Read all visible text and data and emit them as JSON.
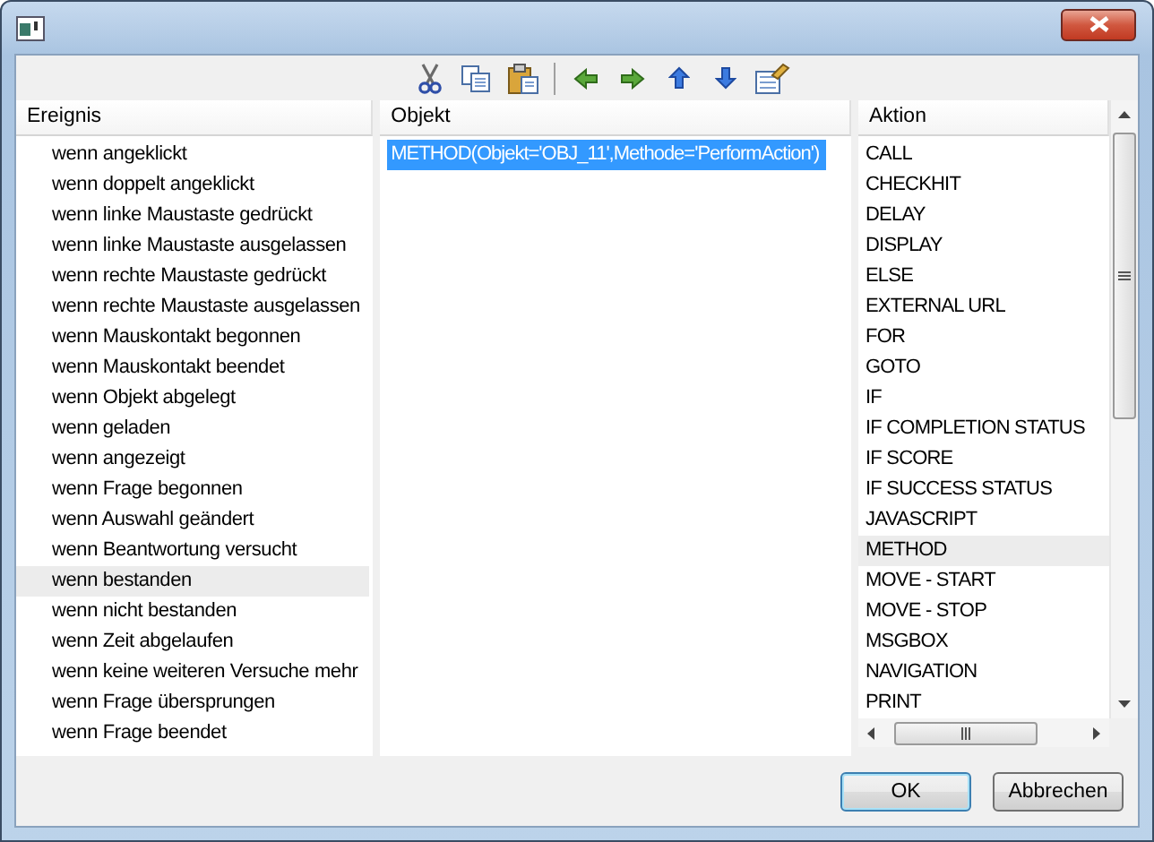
{
  "ereignis": {
    "heading": "Ereignis",
    "items": [
      {
        "label": "wenn angeklickt",
        "selected": false
      },
      {
        "label": "wenn doppelt angeklickt",
        "selected": false
      },
      {
        "label": "wenn linke Maustaste gedrückt",
        "selected": false
      },
      {
        "label": "wenn linke Maustaste ausgelassen",
        "selected": false
      },
      {
        "label": "wenn rechte Maustaste gedrückt",
        "selected": false
      },
      {
        "label": "wenn rechte Maustaste ausgelassen",
        "selected": false
      },
      {
        "label": "wenn Mauskontakt begonnen",
        "selected": false
      },
      {
        "label": "wenn Mauskontakt beendet",
        "selected": false
      },
      {
        "label": "wenn Objekt abgelegt",
        "selected": false
      },
      {
        "label": "wenn geladen",
        "selected": false
      },
      {
        "label": "wenn angezeigt",
        "selected": false
      },
      {
        "label": "wenn Frage begonnen",
        "selected": false
      },
      {
        "label": "wenn Auswahl geändert",
        "selected": false
      },
      {
        "label": "wenn Beantwortung versucht",
        "selected": false
      },
      {
        "label": "wenn bestanden",
        "selected": true
      },
      {
        "label": "wenn nicht bestanden",
        "selected": false
      },
      {
        "label": "wenn Zeit abgelaufen",
        "selected": false
      },
      {
        "label": "wenn keine weiteren Versuche mehr",
        "selected": false
      },
      {
        "label": "wenn Frage übersprungen",
        "selected": false
      },
      {
        "label": "wenn Frage beendet",
        "selected": false
      }
    ]
  },
  "objekt": {
    "heading": "Objekt",
    "items": [
      {
        "label": "METHOD(Objekt='OBJ_11',Methode='PerformAction')",
        "selected": true
      }
    ]
  },
  "aktion": {
    "heading": "Aktion",
    "items": [
      {
        "label": "CALL",
        "selected": false
      },
      {
        "label": "CHECKHIT",
        "selected": false
      },
      {
        "label": "DELAY",
        "selected": false
      },
      {
        "label": "DISPLAY",
        "selected": false
      },
      {
        "label": "ELSE",
        "selected": false
      },
      {
        "label": "EXTERNAL URL",
        "selected": false
      },
      {
        "label": "FOR",
        "selected": false
      },
      {
        "label": "GOTO",
        "selected": false
      },
      {
        "label": "IF",
        "selected": false
      },
      {
        "label": "IF COMPLETION STATUS",
        "selected": false
      },
      {
        "label": "IF SCORE",
        "selected": false
      },
      {
        "label": "IF SUCCESS STATUS",
        "selected": false
      },
      {
        "label": "JAVASCRIPT",
        "selected": false
      },
      {
        "label": "METHOD",
        "selected": true
      },
      {
        "label": "MOVE - START",
        "selected": false
      },
      {
        "label": "MOVE - STOP",
        "selected": false
      },
      {
        "label": "MSGBOX",
        "selected": false
      },
      {
        "label": "NAVIGATION",
        "selected": false
      },
      {
        "label": "PRINT",
        "selected": false
      }
    ]
  },
  "buttons": [
    {
      "label": "OK",
      "default": true
    },
    {
      "label": "Abbrechen",
      "default": false
    }
  ]
}
